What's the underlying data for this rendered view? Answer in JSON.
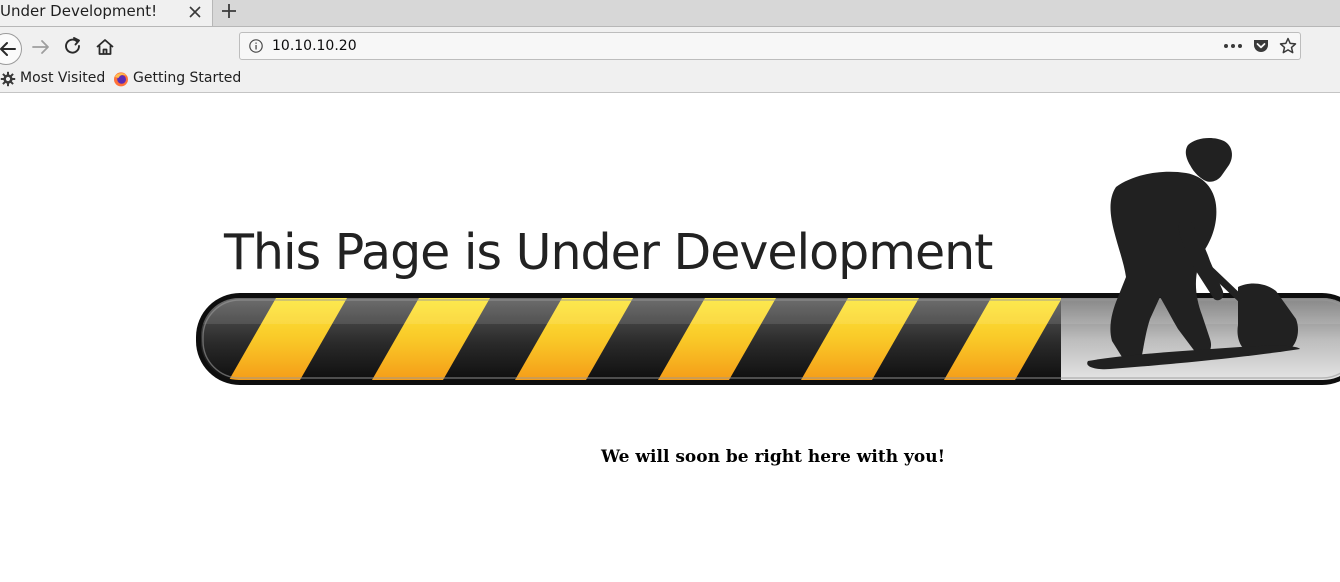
{
  "tab": {
    "title": "Under Development!",
    "close_icon": "close-icon",
    "new_tab_icon": "plus-icon"
  },
  "nav": {
    "back_icon": "arrow-left-icon",
    "forward_icon": "arrow-right-icon",
    "reload_icon": "reload-icon",
    "home_icon": "home-icon"
  },
  "urlbar": {
    "url": "10.10.10.20",
    "info_icon": "info-icon",
    "more_icon": "ellipsis-icon",
    "pocket_icon": "pocket-icon",
    "star_icon": "star-icon"
  },
  "bookmarks": [
    {
      "label": "Most Visited",
      "icon": "gear-icon"
    },
    {
      "label": "Getting Started",
      "icon": "firefox-icon"
    }
  ],
  "page": {
    "heading": "This Page is Under Development",
    "tagline": "We will soon be right here with you!",
    "colors": {
      "stripe_yellow": "#f7d21f",
      "stripe_orange": "#f5a623",
      "stripe_dark": "#2b2b2b",
      "frame": "#111111",
      "silhouette": "#202020"
    }
  }
}
